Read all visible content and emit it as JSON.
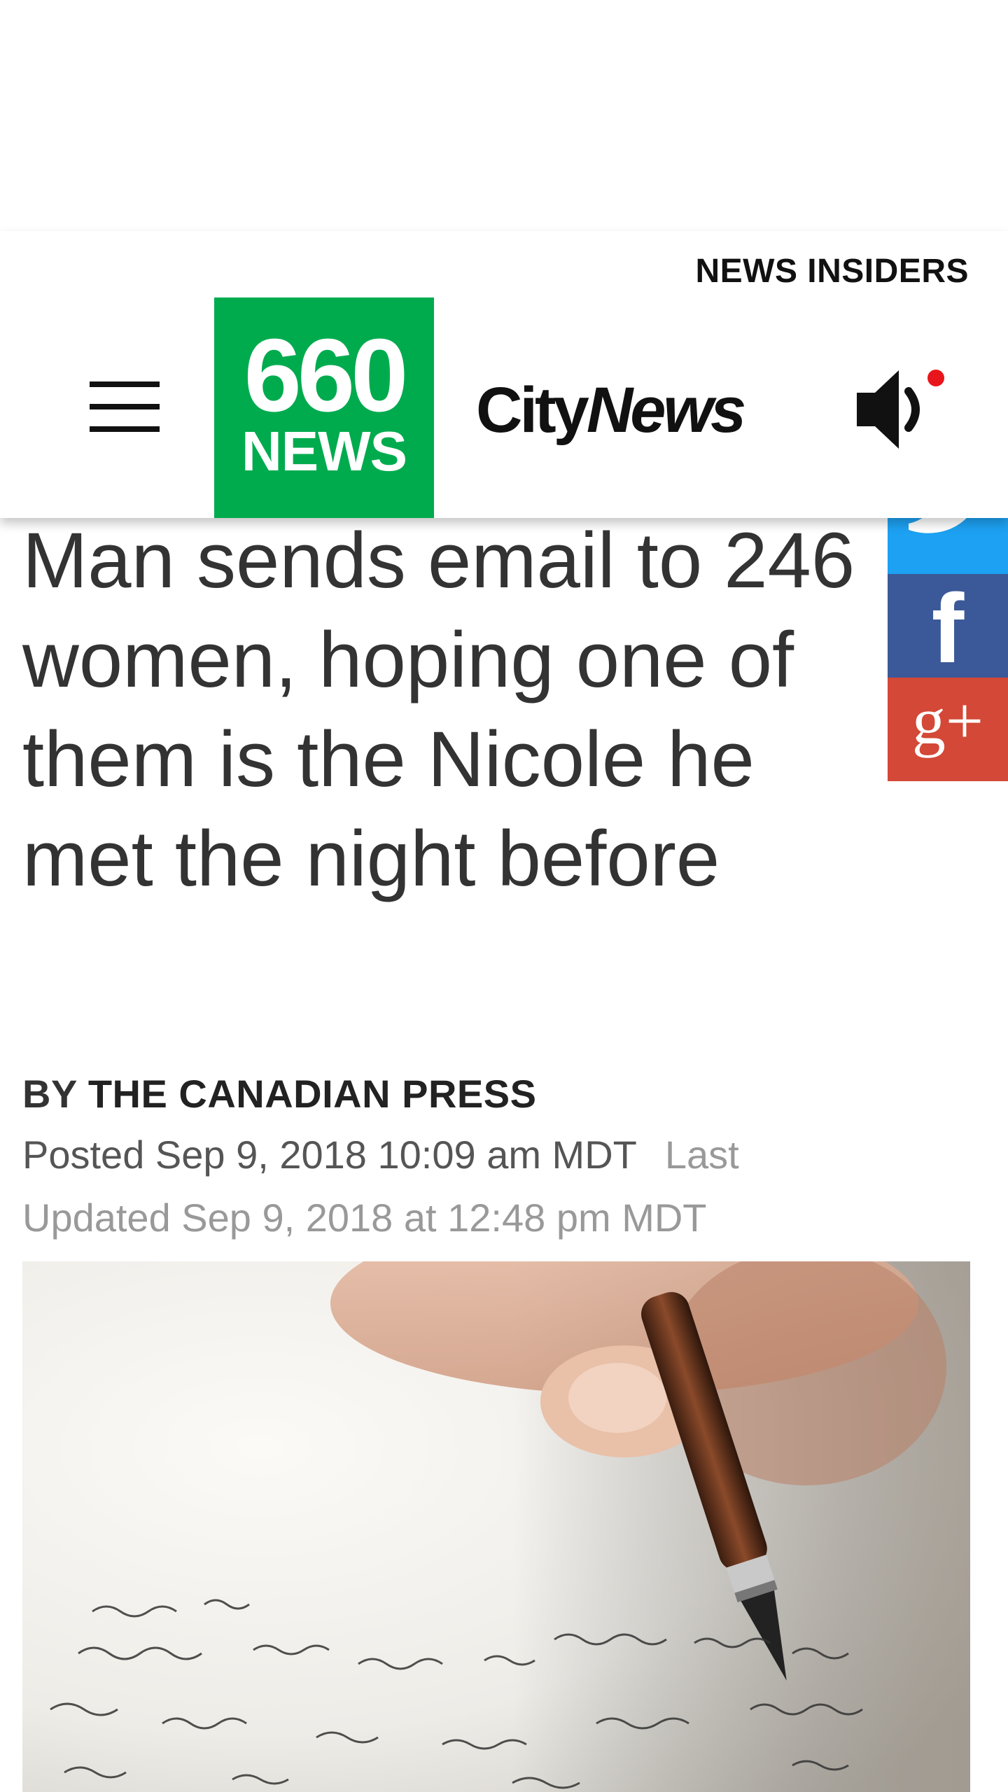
{
  "header": {
    "insiders_link": "NEWS INSIDERS",
    "logo_660": {
      "number": "660",
      "word": "NEWS",
      "color": "#00ab4e"
    },
    "logo_citynews": {
      "city": "City",
      "news": "News"
    },
    "audio_badge_color": "#e8161b"
  },
  "share": {
    "twitter_color": "#1da1f2",
    "facebook_glyph": "f",
    "facebook_color": "#3b5998",
    "google_glyph": "g+",
    "google_color": "#d34836"
  },
  "article": {
    "headline": "Man sends email to 246 women, hoping one of them is the Nicole he met the night before",
    "byline_prefix": "BY",
    "byline_author": "THE CANADIAN PRESS",
    "posted": "Posted Sep 9, 2018 10:09 am MDT",
    "updated": "Last Updated Sep 9, 2018 at 12:48 pm MDT",
    "image_handwriting": "are the"
  }
}
